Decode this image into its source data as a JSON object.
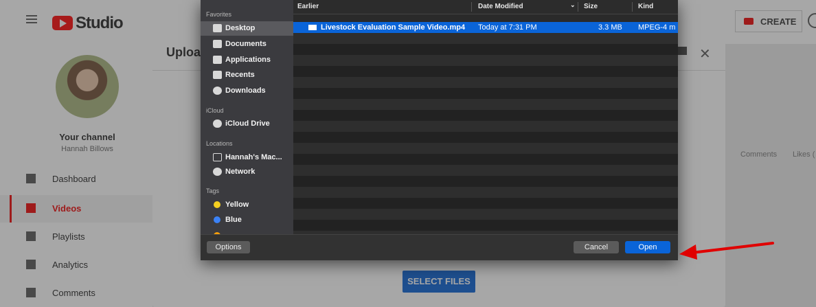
{
  "yt": {
    "logo_text": "Studio",
    "create_label": "CREATE",
    "channel_title": "Your channel",
    "channel_name": "Hannah Billows",
    "nav": [
      {
        "label": "Dashboard",
        "icon": "dashboard-icon"
      },
      {
        "label": "Videos",
        "icon": "videos-icon",
        "active": true
      },
      {
        "label": "Playlists",
        "icon": "playlists-icon"
      },
      {
        "label": "Analytics",
        "icon": "analytics-icon"
      },
      {
        "label": "Comments",
        "icon": "comments-icon"
      }
    ],
    "column_comments": "Comments",
    "column_likes": "Likes (",
    "upload_title": "Upload videos",
    "select_files": "SELECT FILES"
  },
  "dialog": {
    "sidebar": {
      "favorites_heading": "Favorites",
      "favorites": [
        "Desktop",
        "Documents",
        "Applications",
        "Recents",
        "Downloads"
      ],
      "icloud_heading": "iCloud",
      "icloud": [
        "iCloud Drive"
      ],
      "locations_heading": "Locations",
      "locations": [
        "Hannah's Mac...",
        "Network"
      ],
      "tags_heading": "Tags",
      "tags": [
        {
          "label": "Yellow",
          "color": "#f5d020"
        },
        {
          "label": "Blue",
          "color": "#3b82f6"
        }
      ]
    },
    "columns": {
      "name": "Earlier",
      "date": "Date Modified",
      "size": "Size",
      "kind": "Kind"
    },
    "files": [
      {
        "name": "Livestock Evaluation Sample Video.mp4",
        "date": "Today at 7:31 PM",
        "size": "3.3 MB",
        "kind": "MPEG-4 m"
      }
    ],
    "options_label": "Options",
    "cancel_label": "Cancel",
    "open_label": "Open"
  },
  "colors": {
    "accent_blue": "#0a64d8",
    "arrow_red": "#e00000",
    "yt_red": "#ff0000"
  }
}
